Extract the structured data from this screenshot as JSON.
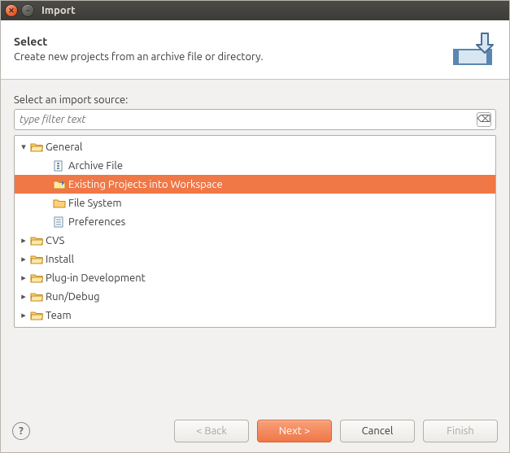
{
  "window": {
    "title": "Import"
  },
  "banner": {
    "heading": "Select",
    "description": "Create new projects from an archive file or directory."
  },
  "source_label": "Select an import source:",
  "filter": {
    "placeholder": "type filter text",
    "value": ""
  },
  "tree": [
    {
      "label": "General",
      "kind": "folder-open",
      "depth": 0,
      "twisty": "down",
      "children": [
        {
          "label": "Archive File",
          "kind": "archive",
          "depth": 1,
          "twisty": "none"
        },
        {
          "label": "Existing Projects into Workspace",
          "kind": "wizard",
          "depth": 1,
          "twisty": "none",
          "selected": true
        },
        {
          "label": "File System",
          "kind": "folder",
          "depth": 1,
          "twisty": "none"
        },
        {
          "label": "Preferences",
          "kind": "prefs",
          "depth": 1,
          "twisty": "none"
        }
      ]
    },
    {
      "label": "CVS",
      "kind": "folder-open",
      "depth": 0,
      "twisty": "right"
    },
    {
      "label": "Install",
      "kind": "folder-open",
      "depth": 0,
      "twisty": "right"
    },
    {
      "label": "Plug-in Development",
      "kind": "folder-open",
      "depth": 0,
      "twisty": "right"
    },
    {
      "label": "Run/Debug",
      "kind": "folder-open",
      "depth": 0,
      "twisty": "right"
    },
    {
      "label": "Team",
      "kind": "folder-open",
      "depth": 0,
      "twisty": "right"
    }
  ],
  "buttons": {
    "back": {
      "label": "< Back",
      "enabled": false
    },
    "next": {
      "label": "Next >",
      "enabled": true,
      "primary": true
    },
    "cancel": {
      "label": "Cancel",
      "enabled": true
    },
    "finish": {
      "label": "Finish",
      "enabled": false
    }
  }
}
